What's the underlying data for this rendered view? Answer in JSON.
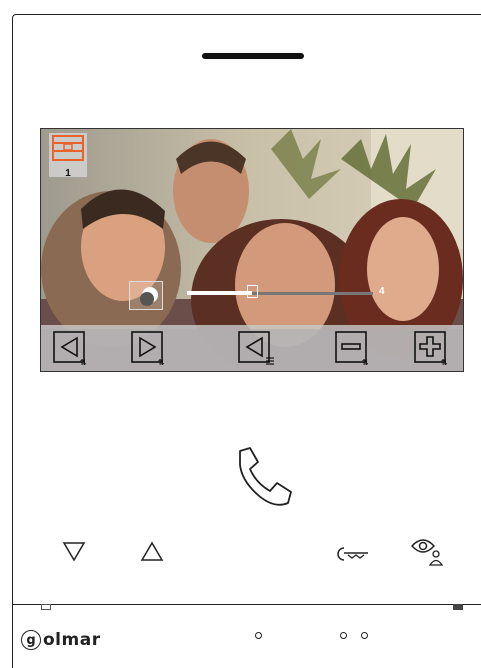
{
  "screen": {
    "camera_number": "1",
    "brightness_level": "4",
    "brightness_fraction": 0.35
  },
  "toolbar": {
    "buttons": [
      "prev-adjust",
      "next-adjust",
      "back-menu",
      "decrease",
      "increase"
    ]
  },
  "colors": {
    "camera_badge_orange": "#e8622c",
    "toolbar_bg": "#c8c8c8",
    "outline": "#222222"
  },
  "brand": {
    "logo_letter": "g",
    "logo_text": "olmar"
  },
  "icons": {
    "call": "phone-icon",
    "down": "triangle-down-icon",
    "up": "triangle-up-icon",
    "door": "key-icon",
    "monitor": "eye-user-icon"
  }
}
